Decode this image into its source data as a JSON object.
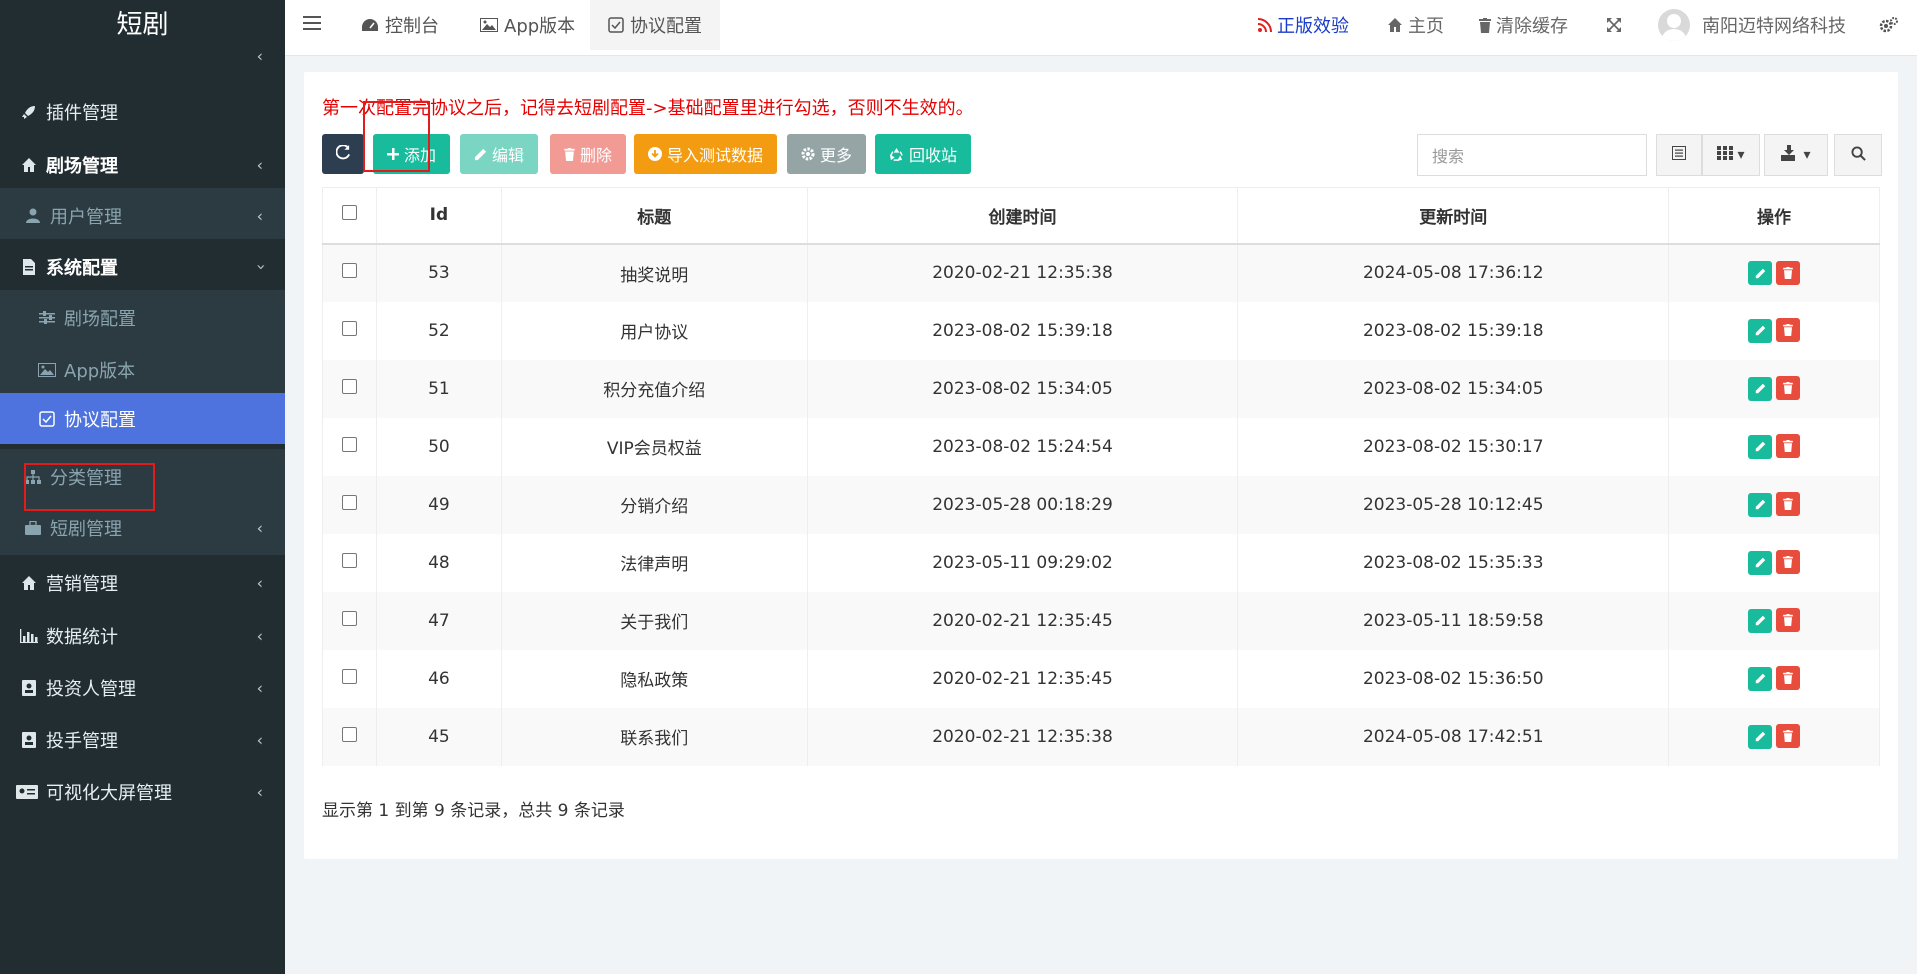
{
  "app": {
    "logo": "短剧"
  },
  "sidebar": {
    "items": [
      {
        "label": "插件管理",
        "icon": "rocket-icon"
      },
      {
        "label": "剧场管理",
        "icon": "home-icon"
      },
      {
        "label": "用户管理",
        "icon": "user-icon"
      },
      {
        "label": "系统配置",
        "icon": "file-icon"
      },
      {
        "label": "剧场配置",
        "icon": "sliders-icon"
      },
      {
        "label": "App版本",
        "icon": "image-icon"
      },
      {
        "label": "协议配置",
        "icon": "agreement-icon"
      },
      {
        "label": "分类管理",
        "icon": "sitemap-icon"
      },
      {
        "label": "短剧管理",
        "icon": "suitcase-icon"
      },
      {
        "label": "营销管理",
        "icon": "home-icon"
      },
      {
        "label": "数据统计",
        "icon": "bar-chart-icon"
      },
      {
        "label": "投资人管理",
        "icon": "id-badge-icon"
      },
      {
        "label": "投手管理",
        "icon": "id-badge-icon"
      },
      {
        "label": "可视化大屏管理",
        "icon": "id-card-icon"
      }
    ]
  },
  "topbar": {
    "tabs": [
      {
        "label": "控制台",
        "icon": "dashboard-icon"
      },
      {
        "label": "App版本",
        "icon": "image-icon"
      },
      {
        "label": "协议配置",
        "icon": "agreement-icon"
      }
    ],
    "right": {
      "license": "正版效验",
      "home": "主页",
      "clear_cache": "清除缓存",
      "username": "南阳迈特网络科技"
    },
    "colors": {
      "license": "#1a3cc8",
      "license_icon": "#e02020"
    }
  },
  "main": {
    "notice": "第一次配置完协议之后，记得去短剧配置->基础配置里进行勾选，否则不生效的。",
    "toolbar": {
      "add": "添加",
      "edit": "编辑",
      "delete": "删除",
      "import": "导入测试数据",
      "more": "更多",
      "recycle": "回收站"
    },
    "search": {
      "placeholder": "搜索"
    },
    "table": {
      "headers": [
        "Id",
        "标题",
        "创建时间",
        "更新时间",
        "操作"
      ],
      "rows": [
        {
          "id": "53",
          "title": "抽奖说明",
          "created": "2020-02-21 12:35:38",
          "updated": "2024-05-08 17:36:12"
        },
        {
          "id": "52",
          "title": "用户协议",
          "created": "2023-08-02 15:39:18",
          "updated": "2023-08-02 15:39:18"
        },
        {
          "id": "51",
          "title": "积分充值介绍",
          "created": "2023-08-02 15:34:05",
          "updated": "2023-08-02 15:34:05"
        },
        {
          "id": "50",
          "title": "VIP会员权益",
          "created": "2023-08-02 15:24:54",
          "updated": "2023-08-02 15:30:17"
        },
        {
          "id": "49",
          "title": "分销介绍",
          "created": "2023-05-28 00:18:29",
          "updated": "2023-05-28 10:12:45"
        },
        {
          "id": "48",
          "title": "法律声明",
          "created": "2023-05-11 09:29:02",
          "updated": "2023-08-02 15:35:33"
        },
        {
          "id": "47",
          "title": "关于我们",
          "created": "2020-02-21 12:35:45",
          "updated": "2023-05-11 18:59:58"
        },
        {
          "id": "46",
          "title": "隐私政策",
          "created": "2020-02-21 12:35:45",
          "updated": "2023-08-02 15:36:50"
        },
        {
          "id": "45",
          "title": "联系我们",
          "created": "2020-02-21 12:35:38",
          "updated": "2024-05-08 17:42:51"
        }
      ]
    },
    "pagination": {
      "summary": "显示第 1 到第 9 条记录，总共 9 条记录"
    }
  }
}
